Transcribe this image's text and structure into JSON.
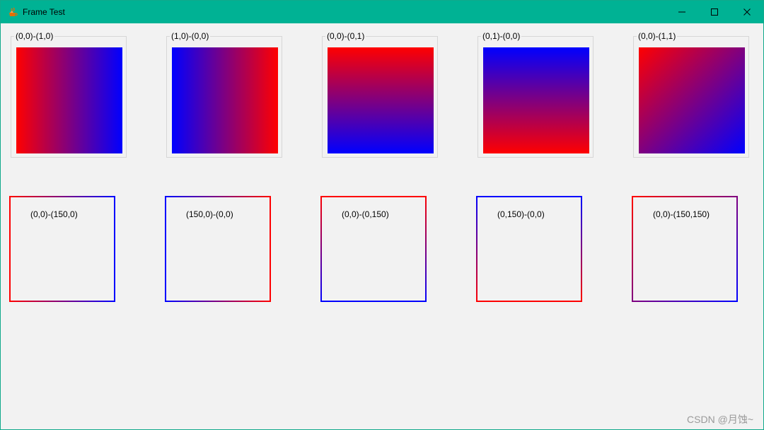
{
  "window": {
    "title": "Frame Test",
    "accent_color": "#00b294",
    "icon": "java-cup-icon",
    "controls": [
      "minimize-icon",
      "maximize-icon",
      "close-icon"
    ]
  },
  "colors": {
    "start": "#ff0000",
    "end": "#0000ff"
  },
  "gradient_panels": [
    {
      "label": "(0,0)-(1,0)"
    },
    {
      "label": "(1,0)-(0,0)"
    },
    {
      "label": "(0,0)-(0,1)"
    },
    {
      "label": "(0,1)-(0,0)"
    },
    {
      "label": "(0,0)-(1,1)"
    }
  ],
  "gradient_frames": [
    {
      "label": "(0,0)-(150,0)"
    },
    {
      "label": "(150,0)-(0,0)"
    },
    {
      "label": "(0,0)-(0,150)"
    },
    {
      "label": "(0,150)-(0,0)"
    },
    {
      "label": "(0,0)-(150,150)"
    }
  ],
  "watermark": "CSDN @月蚀~"
}
